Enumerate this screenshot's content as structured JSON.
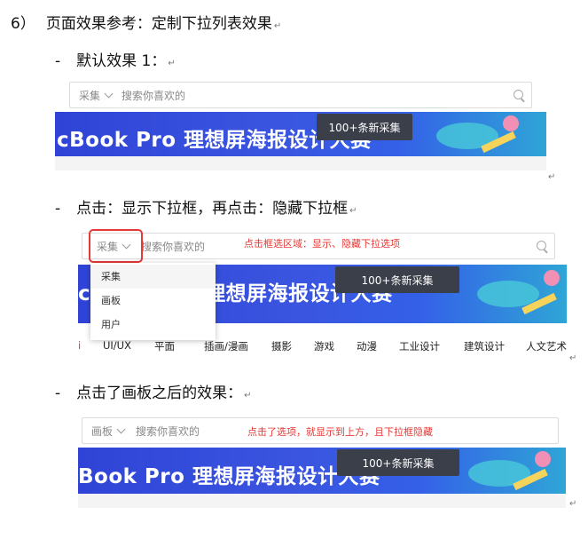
{
  "heading": {
    "number": "6）",
    "text": "页面效果参考：定制下拉列表效果"
  },
  "sections": [
    {
      "dash": "-",
      "label": "默认效果 1："
    },
    {
      "dash": "-",
      "label": "点击：显示下拉框，再点击：隐藏下拉框"
    },
    {
      "dash": "-",
      "label": "点击了画板之后的效果："
    }
  ],
  "paragraph_mark": "↵",
  "shot1": {
    "category": "采集",
    "placeholder": "搜索你喜欢的",
    "banner_text": "cBook Pro  理想屏海报设计大赛",
    "banner_button": "100+条新采集"
  },
  "shot2": {
    "category": "采集",
    "placeholder": "搜索你喜欢的",
    "note": "点击框选区域：显示、隐藏下拉选项",
    "banner_text": "cBook Pro  理想屏海报设计大赛",
    "banner_button": "100+条新采集",
    "dropdown": [
      "采集",
      "画板",
      "用户"
    ],
    "nav_categories": [
      "UI/UX",
      "平面",
      "插画/漫画",
      "摄影",
      "游戏",
      "动漫",
      "工业设计",
      "建筑设计",
      "人文艺术"
    ]
  },
  "shot3": {
    "category": "画板",
    "placeholder": "搜索你喜欢的",
    "note": "点击了选项，就显示到上方，且下拉框隐藏",
    "banner_text": "Book Pro  理想屏海报设计大赛",
    "banner_button": "100+条新采集"
  },
  "colors": {
    "accent_red": "#e53935",
    "banner_blue": "#3a55e0",
    "button_dark": "#3b3f4a"
  }
}
